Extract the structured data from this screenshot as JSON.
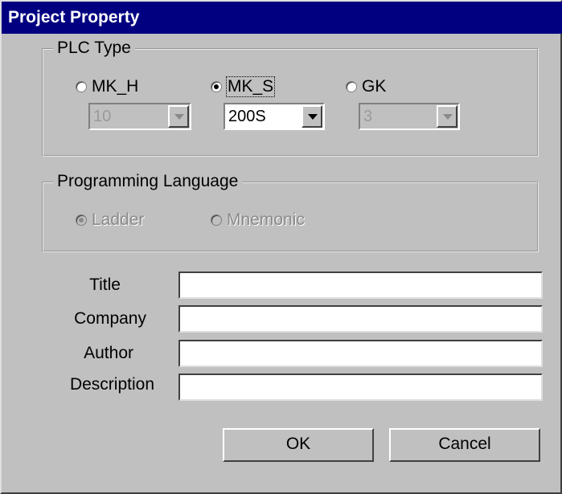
{
  "dialog": {
    "title": "Project Property"
  },
  "plc_type": {
    "legend": "PLC Type",
    "options": [
      {
        "label": "MK_H",
        "checked": false,
        "combo_value": "10",
        "combo_enabled": false
      },
      {
        "label": "MK_S",
        "checked": true,
        "combo_value": "200S",
        "combo_enabled": true
      },
      {
        "label": "GK",
        "checked": false,
        "combo_value": "3",
        "combo_enabled": false
      }
    ]
  },
  "programming_language": {
    "legend": "Programming Language",
    "options": [
      {
        "label": "Ladder",
        "checked": true,
        "enabled": false
      },
      {
        "label": "Mnemonic",
        "checked": false,
        "enabled": false
      }
    ]
  },
  "fields": {
    "title_label": "Title",
    "title_value": "",
    "company_label": "Company",
    "company_value": "",
    "author_label": "Author",
    "author_value": "",
    "description_label": "Description",
    "description_value": ""
  },
  "buttons": {
    "ok": "OK",
    "cancel": "Cancel"
  },
  "colors": {
    "titlebar": "#000080",
    "face": "#c0c0c0"
  }
}
